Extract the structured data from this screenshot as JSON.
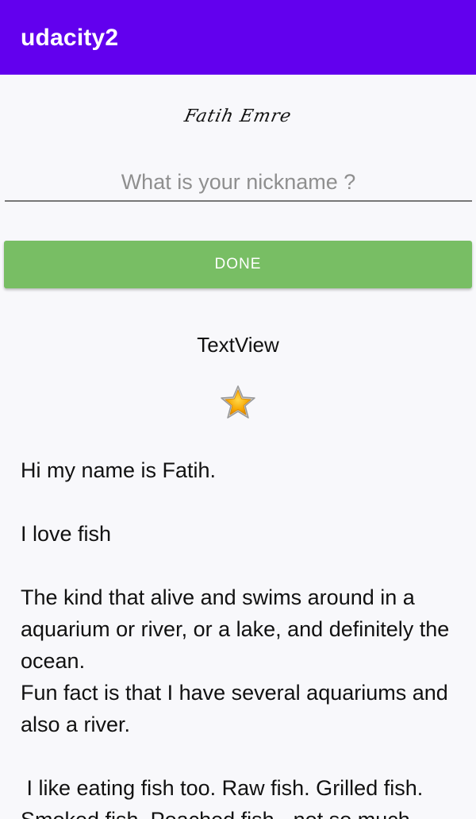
{
  "app_bar": {
    "title": "udacity2",
    "color": "#6200ee"
  },
  "profile": {
    "name": "Fatih Emre"
  },
  "nickname": {
    "value": "",
    "placeholder": "What is your nickname ?"
  },
  "actions": {
    "done_label": "DONE",
    "done_color": "#78be64"
  },
  "nickname_display": {
    "text": "TextView"
  },
  "icons": {
    "star": "star-icon"
  },
  "bio": {
    "text": "Hi my name is Fatih.\n\nI love fish\n\nThe kind that alive and swims around in a aquarium or river, or a lake, and definitely the ocean.\nFun fact is that I have several aquariums and also a river.\n\n I like eating fish too. Raw fish. Grilled fish. Smoked fish. Poached fish - not so much."
  }
}
